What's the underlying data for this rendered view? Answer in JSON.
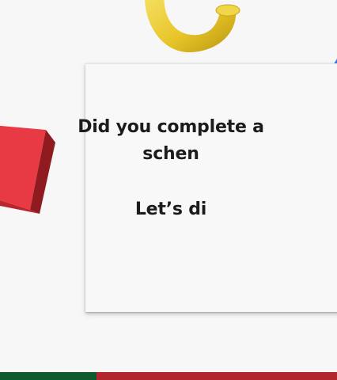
{
  "card": {
    "question_line1": "Did you complete a",
    "question_line2": "schen",
    "prompt_line": "Let’s di"
  },
  "decorations": {
    "ring": "gold-torus-icon",
    "block": "red-block-icon",
    "gem": "blue-gem-icon"
  },
  "colors": {
    "background": "#f7f7f7",
    "ring_gold": "#f2d23c",
    "block_red": "#e8353f",
    "gem_blue": "#3d7cf0",
    "footer_green": "#0f5a2e",
    "footer_red": "#b3262e"
  }
}
